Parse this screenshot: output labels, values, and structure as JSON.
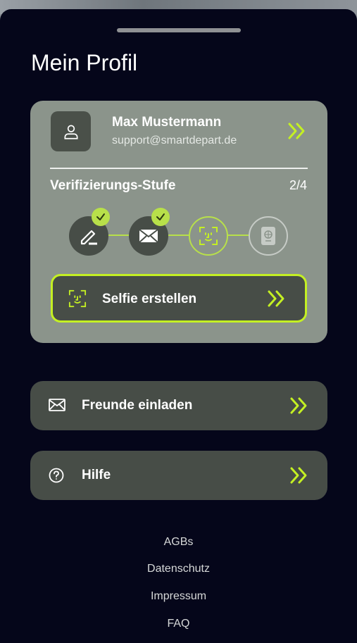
{
  "header": {
    "title": "Mein Profil"
  },
  "profile": {
    "name": "Max Mustermann",
    "email": "support@smartdepart.de"
  },
  "verification": {
    "label": "Verifizierungs-Stufe",
    "count": "2/4",
    "steps": [
      {
        "icon": "signature-icon",
        "status": "done"
      },
      {
        "icon": "mail-icon",
        "status": "done"
      },
      {
        "icon": "face-scan-icon",
        "status": "active"
      },
      {
        "icon": "passport-icon",
        "status": "pending"
      }
    ],
    "action_label": "Selfie erstellen"
  },
  "menu": {
    "invite_label": "Freunde einladen",
    "help_label": "Hilfe"
  },
  "footer": {
    "agb": "AGBs",
    "privacy": "Datenschutz",
    "imprint": "Impressum",
    "faq": "FAQ"
  },
  "colors": {
    "background": "#05061a",
    "card": "#8b948b",
    "button": "#474d47",
    "accent": "#c4f023"
  }
}
